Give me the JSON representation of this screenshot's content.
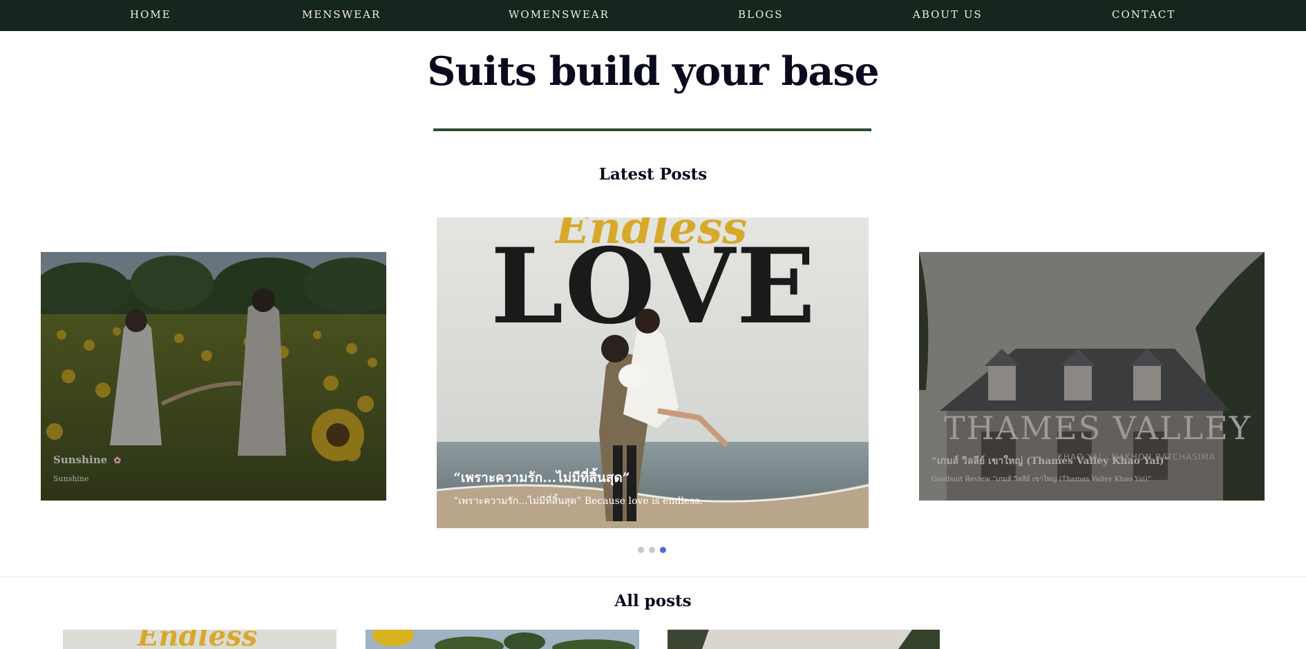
{
  "nav": {
    "items": [
      {
        "label": "HOME"
      },
      {
        "label": "MENSWEAR"
      },
      {
        "label": "WOMENSWEAR"
      },
      {
        "label": "BLOGS"
      },
      {
        "label": "ABOUT US"
      },
      {
        "label": "CONTACT"
      }
    ]
  },
  "hero": {
    "title": "Suits build your base"
  },
  "latest": {
    "heading": "Latest Posts",
    "cards": [
      {
        "title": "Sunshine",
        "icon": "flower-icon",
        "subtitle": "Sunshine"
      },
      {
        "title": "“เพราะความรัก...ไม่มีที่สิ้นสุด”",
        "subtitle": "“เพราะความรัก...ไม่มีที่สิ้นสุด” Because love is endless.",
        "image_text": "LOVE",
        "image_script": "Endless"
      },
      {
        "title": "“เกมส์ วิลลีย์ เขาใหญ่ (Thames Valley Khao Yai)”",
        "subtitle": "Goodsuit Review “เกมส์ วิลลีย์ เขาใหญ่ (Thames Valley Khao Yai)”",
        "image_text": "THAMES VALLEY",
        "image_subtext": "KHAO YAI · NAKHON RATCHASIMA"
      }
    ],
    "pagination": {
      "count": 3,
      "active_index": 2
    }
  },
  "all_posts": {
    "heading": "All posts",
    "thumb_script": "Endless"
  },
  "colors": {
    "nav_bg": "#16251d",
    "rule": "#2a4c33",
    "dot_active": "#4f6ad8",
    "dot_inactive": "#c8c8cc"
  }
}
